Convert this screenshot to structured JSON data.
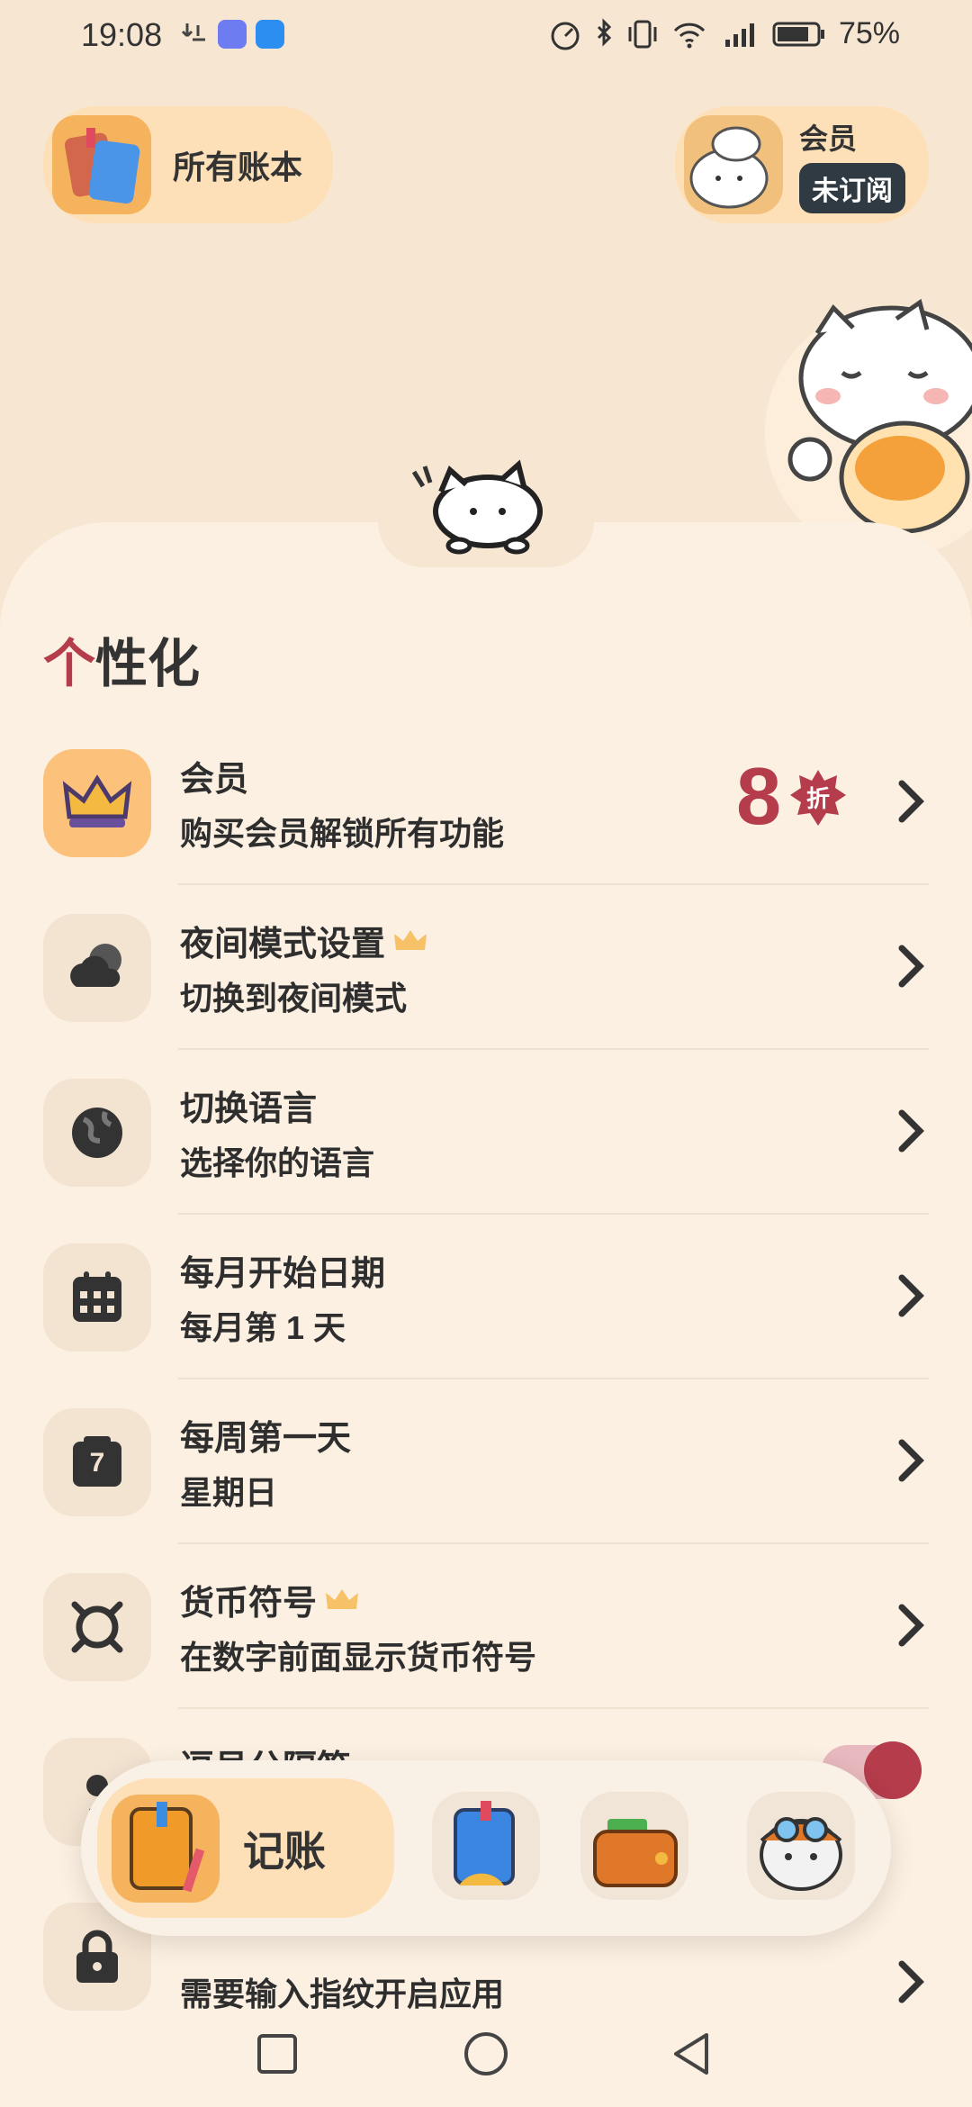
{
  "status": {
    "time": "19:08",
    "battery": "75%"
  },
  "top": {
    "books_label": "所有账本",
    "member_title": "会员",
    "member_status": "未订阅"
  },
  "section": {
    "accent": "个",
    "rest": "性化"
  },
  "items": [
    {
      "title": "会员",
      "subtitle": "购买会员解锁所有功能",
      "discount": "8",
      "discount_unit": "折"
    },
    {
      "title": "夜间模式设置",
      "subtitle": "切换到夜间模式"
    },
    {
      "title": "切换语言",
      "subtitle": "选择你的语言"
    },
    {
      "title": "每月开始日期",
      "subtitle": "每月第 1 天"
    },
    {
      "title": "每周第一天",
      "subtitle": "星期日",
      "icon_text": "7"
    },
    {
      "title": "货币符号",
      "subtitle": "在数字前面显示货币符号"
    },
    {
      "title": "逗号分隔符",
      "subtitle": ""
    },
    {
      "title": "",
      "subtitle": "需要输入指纹开启应用"
    }
  ],
  "dock": {
    "active_label": "记账"
  },
  "colors": {
    "accent": "#b43c4b",
    "background": "#f7e7d2",
    "panel": "#fcf0e2",
    "pill": "#fde0b8",
    "badge_dark": "#2f3a42"
  }
}
